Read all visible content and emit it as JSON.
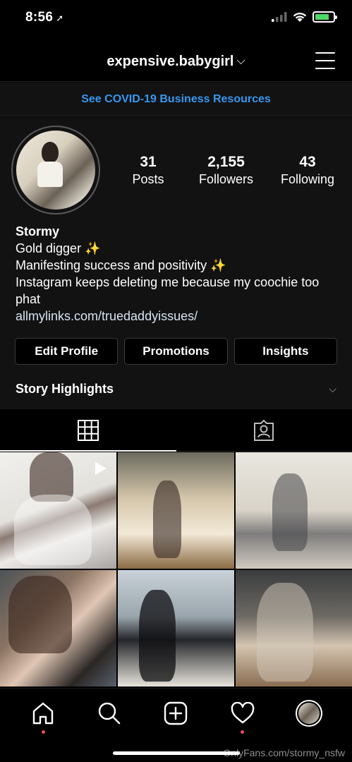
{
  "status_bar": {
    "time": "8:56",
    "location_icon": "location-arrow-icon",
    "signal_icon": "cellular-signal-icon",
    "wifi_icon": "wifi-icon",
    "battery_icon": "battery-charging-icon",
    "battery_level": 0.8,
    "battery_color": "#4cd964"
  },
  "header": {
    "username": "expensive.babygirl",
    "chevron": "⌵",
    "menu_icon": "hamburger-menu-icon"
  },
  "banner": {
    "text": "See COVID-19 Business Resources",
    "color": "#3897f0"
  },
  "profile": {
    "avatar_icon": "profile-avatar",
    "stats": [
      {
        "value": "31",
        "label": "Posts"
      },
      {
        "value": "2,155",
        "label": "Followers"
      },
      {
        "value": "43",
        "label": "Following"
      }
    ],
    "name": "Stormy",
    "bio_lines": [
      "Gold digger ✨",
      "Manifesting success and positivity ✨",
      "Instagram keeps deleting me because my coochie too phat"
    ],
    "link": "allmylinks.com/truedaddyissues/"
  },
  "actions": {
    "edit_profile": "Edit Profile",
    "promotions": "Promotions",
    "insights": "Insights"
  },
  "highlights": {
    "label": "Story Highlights",
    "chevron": "⌵"
  },
  "tabs": [
    {
      "icon": "grid-icon",
      "active": true
    },
    {
      "icon": "tagged-person-icon",
      "active": false
    }
  ],
  "posts": [
    {
      "type": "video",
      "icon": "play-icon"
    },
    {
      "type": "photo"
    },
    {
      "type": "photo"
    },
    {
      "type": "photo"
    },
    {
      "type": "photo"
    },
    {
      "type": "photo"
    }
  ],
  "bottom_nav": [
    {
      "icon": "home-icon",
      "notification": true
    },
    {
      "icon": "search-icon",
      "notification": false
    },
    {
      "icon": "new-post-icon",
      "notification": false
    },
    {
      "icon": "heart-icon",
      "notification": true
    },
    {
      "icon": "profile-avatar-icon",
      "notification": false
    }
  ],
  "watermark": "OnlyFans.com/stormy_nsfw"
}
